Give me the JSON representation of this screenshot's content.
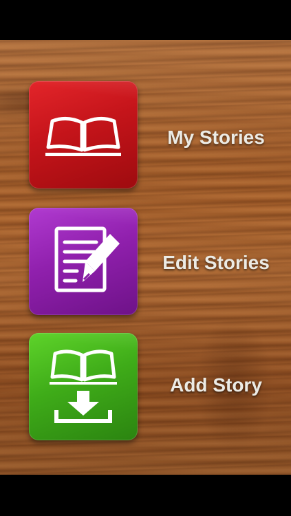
{
  "menu": {
    "items": [
      {
        "label": "My Stories",
        "icon": "open-book-icon",
        "color": "#b80f12"
      },
      {
        "label": "Edit Stories",
        "icon": "document-pen-icon",
        "color": "#8a1fa6"
      },
      {
        "label": "Add Story",
        "icon": "book-download-icon",
        "color": "#3aa517"
      }
    ]
  },
  "background": {
    "texture": "wood-texture",
    "color": "#a45d28"
  }
}
